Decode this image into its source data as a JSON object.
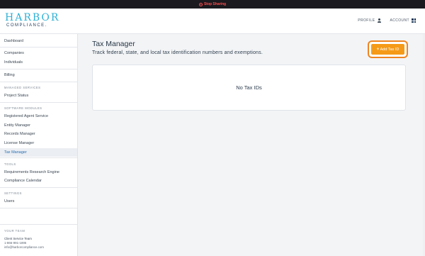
{
  "recording": {
    "stop_label": "Stop Sharing"
  },
  "header": {
    "logo_top": "HARBOR",
    "logo_bottom": "COMPLIANCE.",
    "profile_label": "PROFILE",
    "account_label": "ACCOUNT"
  },
  "sidebar": {
    "dashboard": "Dashboard",
    "companies": "Companies",
    "individuals": "Individuals",
    "billing": "Billing",
    "managed_services_title": "MANAGED SERVICES",
    "project_status": "Project Status",
    "software_modules_title": "SOFTWARE MODULES",
    "registered_agent": "Registered Agent Service",
    "entity_manager": "Entity Manager",
    "records_manager": "Records Manager",
    "license_manager": "License Manager",
    "tax_manager": "Tax Manager",
    "tools_title": "TOOLS",
    "requirements": "Requirements Research Engine",
    "compliance_calendar": "Compliance Calendar",
    "settings_title": "SETTINGS",
    "users": "Users",
    "team_title": "YOUR TEAM",
    "team_name": "Client Service Team",
    "team_phone": "1-866-991-1895",
    "team_email": "info@harborcompliance.com"
  },
  "main": {
    "title": "Tax Manager",
    "subtitle": "Track federal, state, and local tax identification numbers and exemptions.",
    "add_button": "Add Tax ID",
    "empty_message": "No Tax IDs"
  },
  "colors": {
    "accent": "#f59a18",
    "highlight": "#f0841f",
    "brand": "#2eb1d6",
    "active_link": "#2b6fb3"
  },
  "icons": [
    "stop-icon",
    "user-icon",
    "grid-icon",
    "plus-icon"
  ]
}
